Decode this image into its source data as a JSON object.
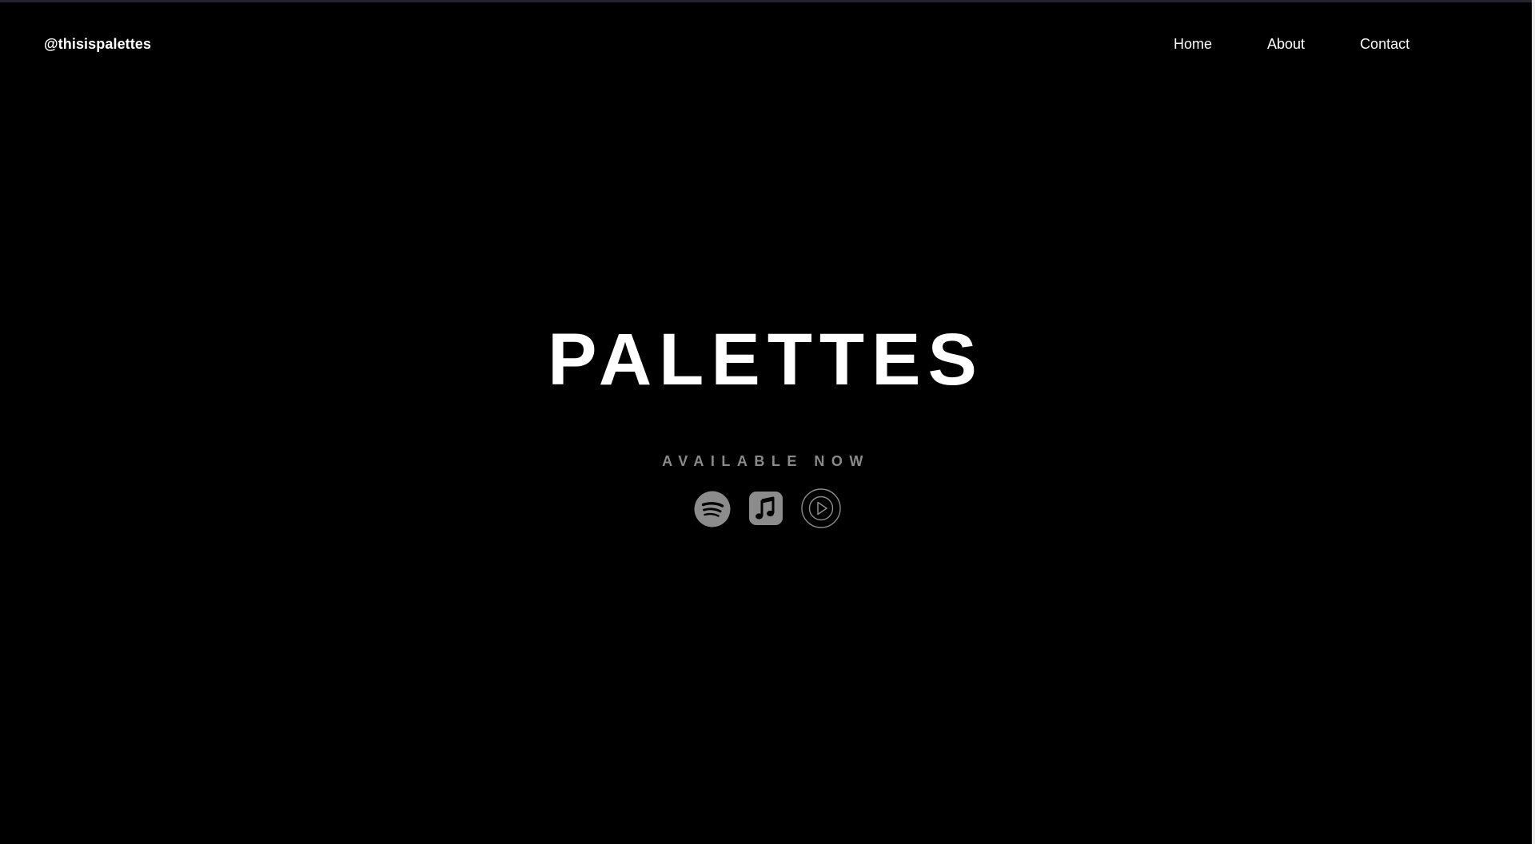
{
  "header": {
    "handle": "@thisispalettes",
    "nav": [
      {
        "label": "Home"
      },
      {
        "label": "About"
      },
      {
        "label": "Contact"
      }
    ]
  },
  "hero": {
    "title": "PALETTES",
    "subtitle": "AVAILABLE NOW"
  },
  "platforms": [
    {
      "icon": "spotify-icon"
    },
    {
      "icon": "apple-music-icon"
    },
    {
      "icon": "youtube-music-icon"
    }
  ],
  "colors": {
    "background": "#000000",
    "text": "#ffffff",
    "muted": "#8a8a8a",
    "icon": "#8c8c8c"
  }
}
